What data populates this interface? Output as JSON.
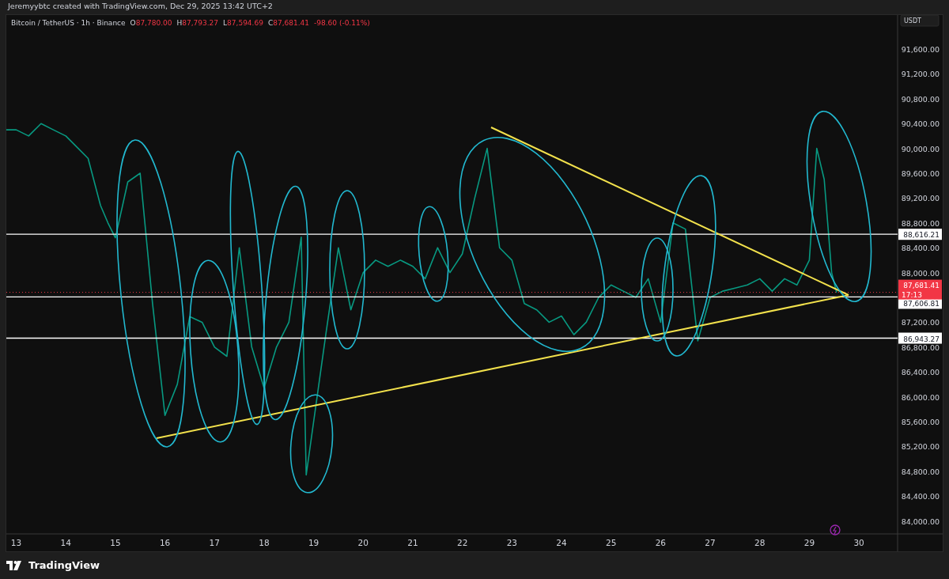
{
  "header": {
    "text": "Jeremyybtc created with TradingView.com, Dec 29, 2025 13:42 UTC+2"
  },
  "legend": {
    "symbol": "Bitcoin / TetherUS · 1h · Binance",
    "ohlc": [
      {
        "key": "O",
        "value": "87,780.00"
      },
      {
        "key": "H",
        "value": "87,793.27"
      },
      {
        "key": "L",
        "value": "87,594.69"
      },
      {
        "key": "C",
        "value": "87,681.41"
      }
    ],
    "change": "-98.60 (-0.11%)"
  },
  "currency": "USDT",
  "price_lines": [
    {
      "label": "88,616.21"
    },
    {
      "label": "87,606.81"
    },
    {
      "label": "86,943.27"
    }
  ],
  "last_price": {
    "label": "87,681.41",
    "countdown": "17:13"
  },
  "chart": {
    "chart_data": {
      "type": "line",
      "x": [
        12.8,
        13,
        13.25,
        13.5,
        13.75,
        14,
        14.25,
        14.45,
        14.7,
        14.85,
        15,
        15.25,
        15.5,
        15.75,
        16,
        16.25,
        16.5,
        16.75,
        17,
        17.25,
        17.5,
        17.75,
        18,
        18.25,
        18.5,
        18.75,
        18.85,
        19,
        19.25,
        19.5,
        19.75,
        20,
        20.25,
        20.5,
        20.75,
        21,
        21.25,
        21.5,
        21.75,
        22,
        22.25,
        22.5,
        22.75,
        23,
        23.25,
        23.5,
        23.75,
        24,
        24.25,
        24.5,
        24.75,
        25,
        25.25,
        25.5,
        25.75,
        26,
        26.25,
        26.5,
        26.75,
        27,
        27.25,
        27.5,
        27.75,
        28,
        28.25,
        28.5,
        28.75,
        29,
        29.15,
        29.3,
        29.45,
        29.55
      ],
      "xlim": [
        12.8,
        31.69
      ],
      "ylim": [
        83510,
        92148
      ],
      "series": [
        {
          "color": "#089981",
          "values": [
            90300,
            90300,
            90200,
            90400,
            90300,
            90200,
            90000,
            89840,
            89080,
            88800,
            88560,
            89460,
            89600,
            87500,
            85700,
            86200,
            87290,
            87200,
            86800,
            86650,
            88400,
            86800,
            86140,
            86800,
            87200,
            88570,
            84740,
            85600,
            87030,
            88400,
            87400,
            88000,
            88200,
            88100,
            88200,
            88100,
            87900,
            88400,
            88000,
            88300,
            89200,
            90000,
            88400,
            88200,
            87500,
            87400,
            87200,
            87300,
            87000,
            87200,
            87600,
            87800,
            87700,
            87600,
            87900,
            87200,
            88800,
            88700,
            86900,
            87600,
            87700,
            87750,
            87800,
            87900,
            87700,
            87900,
            87800,
            88200,
            90000,
            89500,
            88000,
            87680
          ]
        }
      ],
      "xticks": [
        {
          "value": 13,
          "label": "13"
        },
        {
          "value": 14,
          "label": "14"
        },
        {
          "value": 15,
          "label": "15"
        },
        {
          "value": 16,
          "label": "16"
        },
        {
          "value": 17,
          "label": "17"
        },
        {
          "value": 18,
          "label": "18"
        },
        {
          "value": 19,
          "label": "19"
        },
        {
          "value": 20,
          "label": "20"
        },
        {
          "value": 21,
          "label": "21"
        },
        {
          "value": 22,
          "label": "22"
        },
        {
          "value": 23,
          "label": "23"
        },
        {
          "value": 24,
          "label": "24"
        },
        {
          "value": 25,
          "label": "25"
        },
        {
          "value": 26,
          "label": "26"
        },
        {
          "value": 27,
          "label": "27"
        },
        {
          "value": 28,
          "label": "28"
        },
        {
          "value": 29,
          "label": "29"
        },
        {
          "value": 30,
          "label": "30"
        }
      ],
      "yticks": [
        {
          "value": 84000,
          "label": "84,000.00"
        },
        {
          "value": 84400,
          "label": "84,400.00"
        },
        {
          "value": 84800,
          "label": "84,800.00"
        },
        {
          "value": 85200,
          "label": "85,200.00"
        },
        {
          "value": 85600,
          "label": "85,600.00"
        },
        {
          "value": 86000,
          "label": "86,000.00"
        },
        {
          "value": 86400,
          "label": "86,400.00"
        },
        {
          "value": 86800,
          "label": "86,800.00"
        },
        {
          "value": 87200,
          "label": "87,200.00"
        },
        {
          "value": 88000,
          "label": "88,000.00"
        },
        {
          "value": 88400,
          "label": "88,400.00"
        },
        {
          "value": 88800,
          "label": "88,800.00"
        },
        {
          "value": 89200,
          "label": "89,200.00"
        },
        {
          "value": 89600,
          "label": "89,600.00"
        },
        {
          "value": 90000,
          "label": "90,000.00"
        },
        {
          "value": 90400,
          "label": "90,400.00"
        },
        {
          "value": 90800,
          "label": "90,800.00"
        },
        {
          "value": 91200,
          "label": "91,200.00"
        },
        {
          "value": 91600,
          "label": "91,600.00"
        }
      ]
    }
  },
  "footer": {
    "brand": "TradingView"
  }
}
